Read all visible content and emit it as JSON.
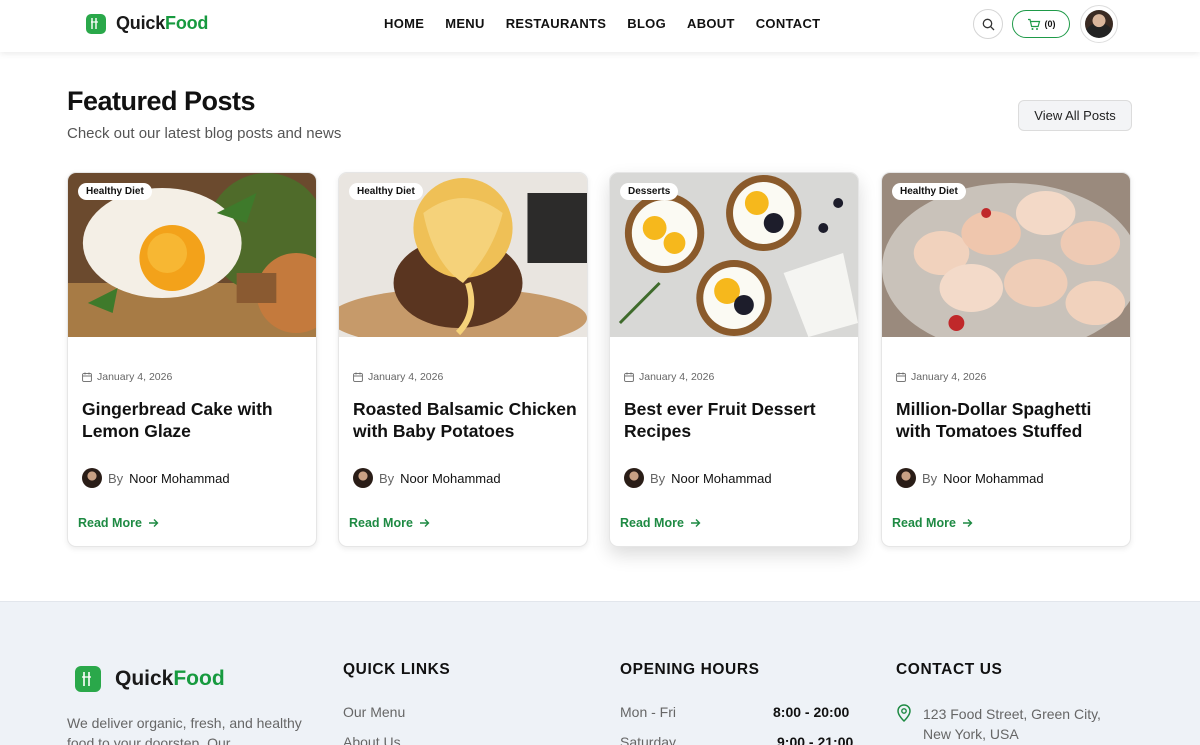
{
  "header": {
    "brand_part1": "Quick",
    "brand_part2": "Food",
    "nav": [
      "HOME",
      "MENU",
      "RESTAURANTS",
      "BLOG",
      "ABOUT",
      "CONTACT"
    ],
    "cart_count": "(0)"
  },
  "featured": {
    "title": "Featured Posts",
    "subtitle": "Check out our latest blog posts and news",
    "view_all": "View All Posts"
  },
  "posts": [
    {
      "tag": "Healthy Diet",
      "date": "January 4, 2026",
      "title": "Gingerbread Cake with Lemon Glaze",
      "by": "By",
      "author": "Noor Mohammad",
      "read_more": "Read More"
    },
    {
      "tag": "Healthy Diet",
      "date": "January 4, 2026",
      "title": "Roasted Balsamic Chicken with Baby Potatoes",
      "by": "By",
      "author": "Noor Mohammad",
      "read_more": "Read More"
    },
    {
      "tag": "Desserts",
      "date": "January 4, 2026",
      "title": "Best ever Fruit Dessert Recipes",
      "by": "By",
      "author": "Noor Mohammad",
      "read_more": "Read More"
    },
    {
      "tag": "Healthy Diet",
      "date": "January 4, 2026",
      "title": "Million-Dollar Spaghetti with Tomatoes Stuffed",
      "by": "By",
      "author": "Noor Mohammad",
      "read_more": "Read More"
    }
  ],
  "footer": {
    "brand_part1": "Quick",
    "brand_part2": "Food",
    "description": "We deliver organic, fresh, and healthy food to your doorstep. Our",
    "quick_links_heading": "QUICK LINKS",
    "quick_links": [
      "Our Menu",
      "About Us"
    ],
    "hours_heading": "OPENING HOURS",
    "hours": [
      {
        "day": "Mon - Fri",
        "time": "8:00 - 20:00"
      },
      {
        "day": "Saturday",
        "time": "9:00 - 21:00"
      }
    ],
    "contact_heading": "CONTACT US",
    "address": "123 Food Street, Green City, New York, USA"
  },
  "colors": {
    "brand_green": "#179a3f",
    "footer_bg": "#eef2f7"
  }
}
